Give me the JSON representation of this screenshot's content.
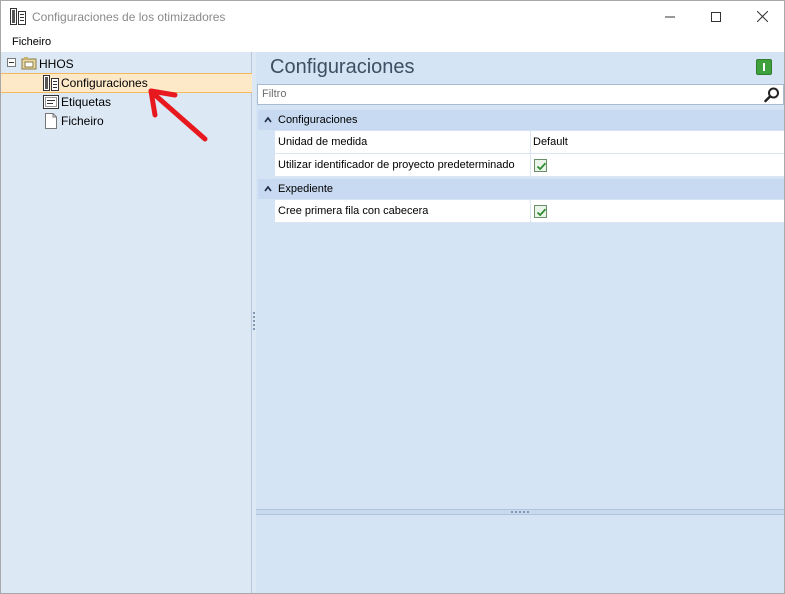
{
  "window": {
    "title": "Configuraciones de los otimizadores"
  },
  "menu": {
    "items": [
      "Ficheiro"
    ]
  },
  "tree": {
    "root_label": "HHOS",
    "items": [
      {
        "label": "Configuraciones",
        "icon": "config-icon",
        "selected": true
      },
      {
        "label": "Etiquetas",
        "icon": "label-icon"
      },
      {
        "label": "Ficheiro",
        "icon": "file-icon"
      }
    ]
  },
  "panel": {
    "title": "Configuraciones",
    "filter_placeholder": "Filtro",
    "categories": [
      {
        "label": "Configuraciones",
        "properties": [
          {
            "name": "Unidad de medida",
            "value": "Default"
          },
          {
            "name": "Utilizar identificador de proyecto predeterminado",
            "checked": true
          }
        ]
      },
      {
        "label": "Expediente",
        "properties": [
          {
            "name": "Cree primera fila con cabecera",
            "checked": true
          }
        ]
      }
    ]
  },
  "colors": {
    "selection": "#fde8c8",
    "pane_bg": "#d5e4f5",
    "accent_green": "#3ea13c",
    "annotation_red": "#e8191e"
  }
}
